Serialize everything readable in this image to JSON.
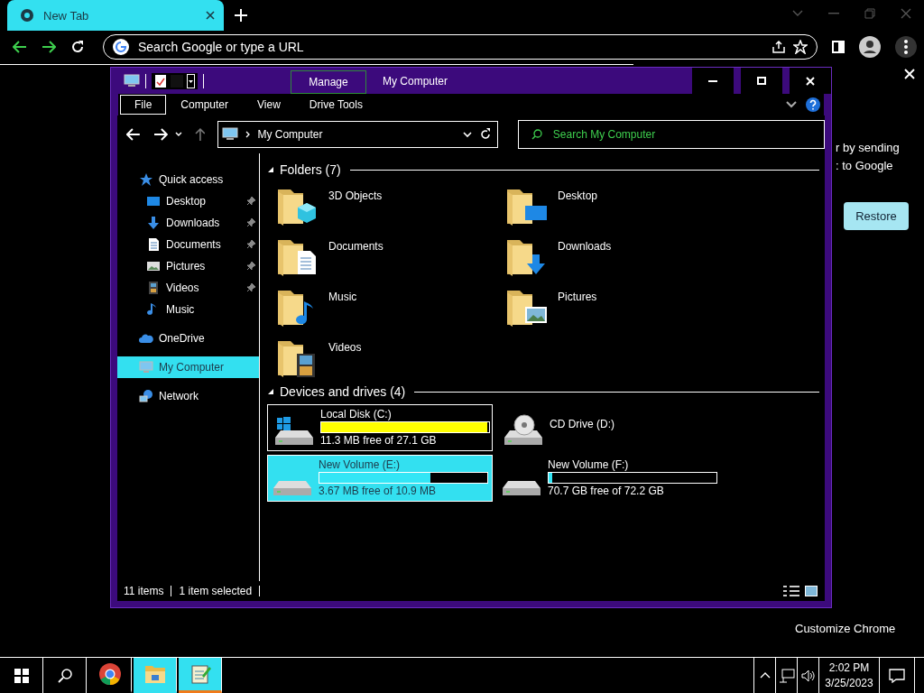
{
  "browser": {
    "tab": {
      "title": "New Tab"
    },
    "address_bar": {
      "placeholder": "Search Google or type a URL"
    }
  },
  "side_panel": {
    "texts": [
      "r by sending",
      ": to Google"
    ],
    "button": "Restore",
    "footer_link": "Customize Chrome"
  },
  "explorer": {
    "context_tab": "Manage",
    "title": "My Computer",
    "ribbon_tabs": [
      {
        "label": "File",
        "selected": true
      },
      {
        "label": "Computer",
        "selected": false
      },
      {
        "label": "View",
        "selected": false
      },
      {
        "label": "Drive Tools",
        "selected": false
      }
    ],
    "breadcrumb": "My Computer",
    "search": {
      "placeholder": "Search My Computer"
    },
    "navigation": [
      {
        "label": "Quick access",
        "kind": "star",
        "selected": false,
        "children": [
          {
            "label": "Desktop",
            "kind": "desktop",
            "pinned": true,
            "selected": false
          },
          {
            "label": "Downloads",
            "kind": "downloads",
            "pinned": true,
            "selected": false
          },
          {
            "label": "Documents",
            "kind": "documents",
            "pinned": true,
            "selected": false
          },
          {
            "label": "Pictures",
            "kind": "pictures",
            "pinned": true,
            "selected": false
          },
          {
            "label": "Videos",
            "kind": "videos",
            "pinned": true,
            "selected": false
          },
          {
            "label": "Music",
            "kind": "music",
            "pinned": false,
            "selected": false
          }
        ]
      },
      {
        "label": "OneDrive",
        "kind": "cloud",
        "selected": false
      },
      {
        "label": "My Computer",
        "kind": "computer",
        "selected": true
      },
      {
        "label": "Network",
        "kind": "network",
        "selected": false
      }
    ],
    "groups": [
      {
        "title": "Folders (7)",
        "kind": "folders",
        "expanded": true,
        "items": [
          {
            "name": "3D Objects",
            "kind": "objects"
          },
          {
            "name": "Desktop",
            "kind": "desktop"
          },
          {
            "name": "Documents",
            "kind": "documents"
          },
          {
            "name": "Downloads",
            "kind": "downloads"
          },
          {
            "name": "Music",
            "kind": "music"
          },
          {
            "name": "Pictures",
            "kind": "pictures"
          },
          {
            "name": "Videos",
            "kind": "videos"
          }
        ]
      },
      {
        "title": "Devices and drives (4)",
        "kind": "drives",
        "expanded": true,
        "items": [
          {
            "name": "Local Disk (C:)",
            "kind": "system",
            "level": 0.99,
            "color": "#ffff00",
            "free_text": "11.3 MB free of 27.1 GB",
            "selected": false,
            "focused": true
          },
          {
            "name": "CD Drive (D:)",
            "kind": "optical",
            "selected": false,
            "focused": false
          },
          {
            "name": "New Volume (E:)",
            "kind": "volume",
            "level": 0.66,
            "color": "#33e6f6",
            "free_text": "3.67 MB free of 10.9 MB",
            "selected": true,
            "focused": false
          },
          {
            "name": "New Volume (F:)",
            "kind": "volume",
            "level": 0.02,
            "color": "#33e6f6",
            "free_text": "70.7 GB free of 72.2 GB",
            "selected": false,
            "focused": false
          }
        ]
      }
    ],
    "status_bar": {
      "item_count": "11 items",
      "selection": "1 item selected"
    }
  },
  "taskbar": {
    "apps": [
      {
        "kind": "browser",
        "highlighted": false,
        "selected": false
      },
      {
        "kind": "files",
        "highlighted": true,
        "selected": false
      },
      {
        "kind": "editor",
        "highlighted": true,
        "selected": true
      }
    ],
    "clock_time": "2:02 PM",
    "clock_date": "3/25/2023"
  }
}
